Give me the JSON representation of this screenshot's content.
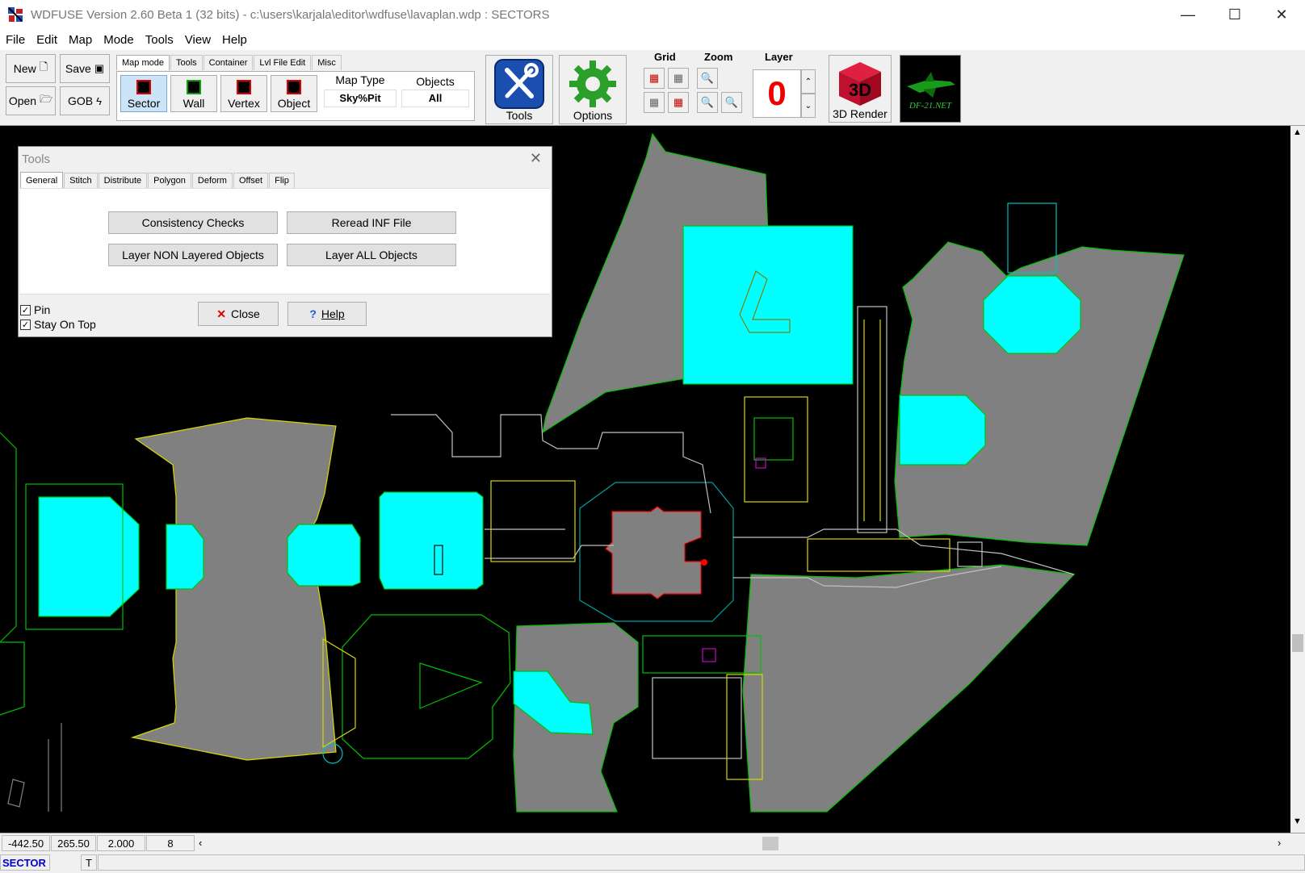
{
  "window": {
    "title": "WDFUSE Version 2.60 Beta 1 (32 bits)  -  c:\\users\\karjala\\editor\\wdfuse\\lavaplan.wdp : SECTORS",
    "minimize": "—",
    "maximize": "☐",
    "close": "✕"
  },
  "menu": [
    "File",
    "Edit",
    "Map",
    "Mode",
    "Tools",
    "View",
    "Help"
  ],
  "toolbar": {
    "new_label": "New",
    "save_label": "Save",
    "open_label": "Open",
    "gob_label": "GOB",
    "tabs": [
      "Map mode",
      "Tools",
      "Container",
      "Lvl File Edit",
      "Misc"
    ],
    "modes": [
      "Sector",
      "Wall",
      "Vertex",
      "Object"
    ],
    "map_type_label": "Map Type",
    "map_type_value": "Sky%Pit",
    "objects_label": "Objects",
    "objects_value": "All",
    "tools_label": "Tools",
    "options_label": "Options",
    "grid_label": "Grid",
    "zoom_label": "Zoom",
    "layer_label": "Layer",
    "layer_value": "0",
    "render_label": "3D Render",
    "render_icon_text": "3D",
    "df21_label": "DF-21.NET"
  },
  "dialog": {
    "title": "Tools",
    "tabs": [
      "General",
      "Stitch",
      "Distribute",
      "Polygon",
      "Deform",
      "Offset",
      "Flip"
    ],
    "buttons": {
      "consistency": "Consistency Checks",
      "reread": "Reread INF File",
      "layer_non": "Layer NON Layered Objects",
      "layer_all": "Layer ALL Objects",
      "close": "Close",
      "help": "Help"
    },
    "pin": "Pin",
    "stay_on_top": "Stay On Top"
  },
  "status": {
    "x": "-442.50",
    "y": "265.50",
    "zoom": "2.000",
    "grid": "8",
    "mode": "SECTOR",
    "t": "T"
  },
  "colors": {
    "sector_fill": "#808080",
    "cyan_fill": "#00ffff",
    "outline_green": "#00c000",
    "outline_yellow": "#d8d800",
    "selected_red": "#ff0000",
    "mode_text_blue": "#0000cc"
  }
}
